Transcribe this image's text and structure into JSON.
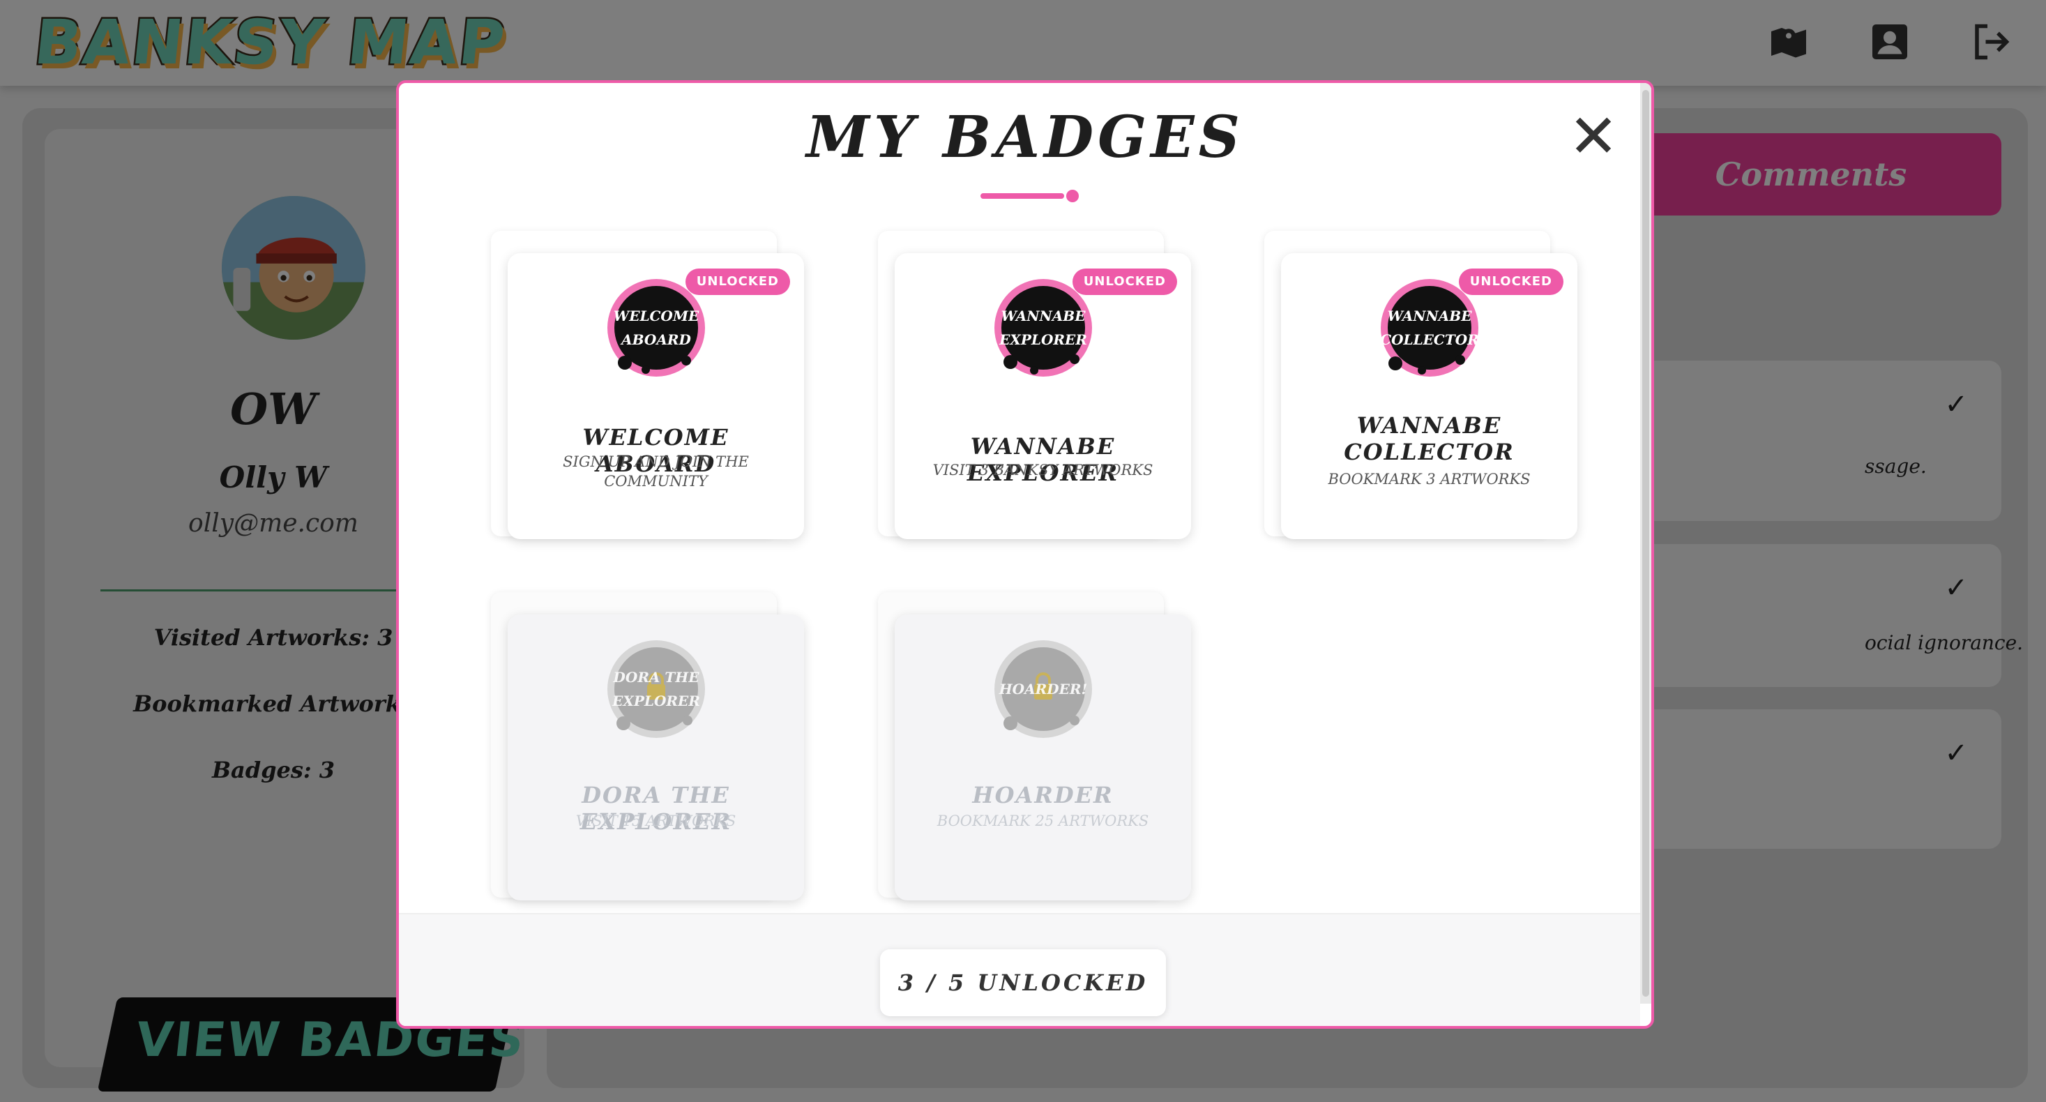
{
  "app": {
    "logo_text": "BANKSY MAP",
    "nav": [
      {
        "name": "map",
        "icon": "map-icon"
      },
      {
        "name": "profile",
        "icon": "profile-icon"
      },
      {
        "name": "logout",
        "icon": "logout-icon"
      }
    ]
  },
  "profile": {
    "initials": "OW",
    "name": "Olly W",
    "email": "olly@me.com",
    "visited": "Visited Artworks: 3",
    "bookmarked": "Bookmarked Artworks",
    "badges": "Badges: 3",
    "view_badges_label": "VIEW BADGES"
  },
  "right": {
    "comments_tab": "Comments",
    "comments": [
      {
        "text": "ssage.",
        "check": "✓"
      },
      {
        "text": "ocial ignorance.",
        "check": "✓"
      },
      {
        "text": "",
        "check": "✓"
      }
    ]
  },
  "modal": {
    "title": "MY BADGES",
    "close_label": "✕",
    "badges": [
      {
        "emblem": "WELCOME\nABOARD",
        "name": "WELCOME ABOARD",
        "desc": "SIGN UP AND JOIN THE COMMUNITY",
        "status": "UNLOCKED",
        "unlocked": true
      },
      {
        "emblem": "WANNABE\nEXPLORER",
        "name": "WANNABE EXPLORER",
        "desc": "VISIT 3 BANKSY ARTWORKS",
        "status": "UNLOCKED",
        "unlocked": true
      },
      {
        "emblem": "WANNABE\nCOLLECTOR",
        "name": "WANNABE COLLECTOR",
        "desc": "BOOKMARK 3 ARTWORKS",
        "status": "UNLOCKED",
        "unlocked": true
      },
      {
        "emblem": "DORA THE\nEXPLORER",
        "name": "DORA THE EXPLORER",
        "desc": "VISIT 15 ARTWORKS",
        "status": "",
        "unlocked": false
      },
      {
        "emblem": "HOARDER!",
        "name": "HOARDER",
        "desc": "BOOKMARK 25 ARTWORKS",
        "status": "",
        "unlocked": false
      }
    ],
    "footer_label": "3 / 5 UNLOCKED"
  },
  "colors": {
    "accent": "#ee5aa8",
    "brand_teal": "#5fd1b2",
    "emblem_dark": "#111111",
    "locked_grey": "#b9bdc4"
  }
}
